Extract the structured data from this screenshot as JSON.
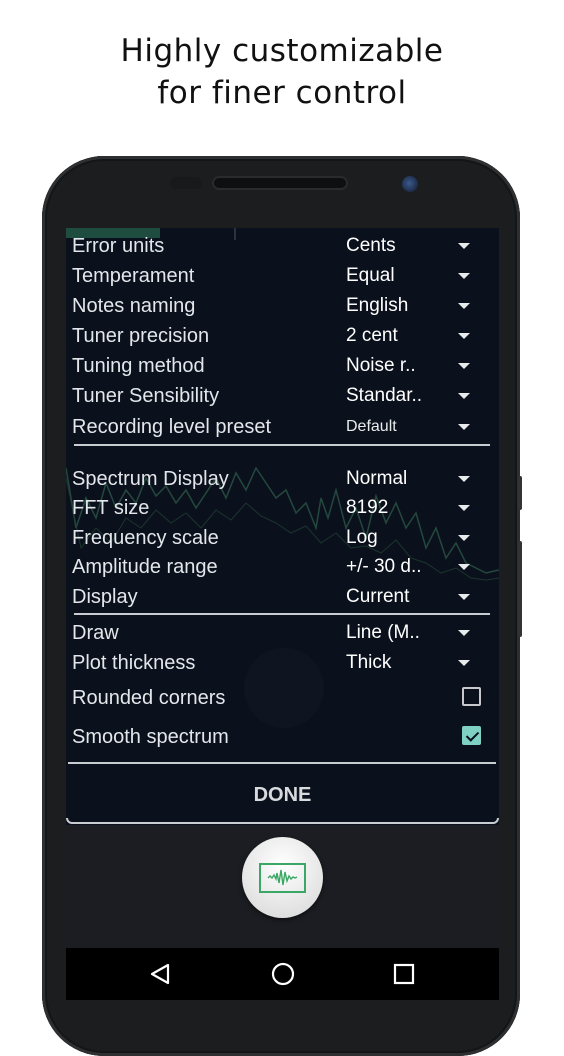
{
  "headline": {
    "line1": "Highly customizable",
    "line2": "for finer control"
  },
  "settings": {
    "tuner_group": [
      {
        "label": "Error units",
        "value": "Cents",
        "type": "dropdown"
      },
      {
        "label": "Temperament",
        "value": "Equal",
        "type": "dropdown"
      },
      {
        "label": "Notes naming",
        "value": "English",
        "type": "dropdown"
      },
      {
        "label": "Tuner precision",
        "value": "2 cent",
        "type": "dropdown"
      },
      {
        "label": "Tuning method",
        "value": "Noise r..",
        "type": "dropdown"
      },
      {
        "label": "Tuner Sensibility",
        "value": "Standar..",
        "type": "dropdown"
      },
      {
        "label": "Recording level preset",
        "value": "Default",
        "type": "dropdown"
      }
    ],
    "spectrum_group": [
      {
        "label": "Spectrum Display",
        "value": "Normal",
        "type": "dropdown"
      },
      {
        "label": "FFT size",
        "value": "8192",
        "type": "dropdown"
      },
      {
        "label": "Frequency scale",
        "value": "Log",
        "type": "dropdown"
      },
      {
        "label": "Amplitude range",
        "value": "+/- 30 d..",
        "type": "dropdown"
      },
      {
        "label": "Display",
        "value": "Current",
        "type": "dropdown"
      }
    ],
    "draw_group": [
      {
        "label": "Draw",
        "value": "Line (M..",
        "type": "dropdown"
      },
      {
        "label": "Plot thickness",
        "value": "Thick",
        "type": "dropdown"
      }
    ],
    "checkboxes": [
      {
        "label": "Rounded corners",
        "checked": false
      },
      {
        "label": "Smooth spectrum",
        "checked": true
      }
    ],
    "done_label": "DONE"
  },
  "fab": {
    "icon": "waveform-icon",
    "accent": "#3aa864"
  },
  "navbar": {
    "back_icon": "back-triangle-icon",
    "home_icon": "home-circle-icon",
    "recents_icon": "recents-square-icon"
  },
  "colors": {
    "screen_bg": "#0b111c",
    "checkbox_accent": "#7ed1c3",
    "spectrum_line": "#2e5a48"
  }
}
